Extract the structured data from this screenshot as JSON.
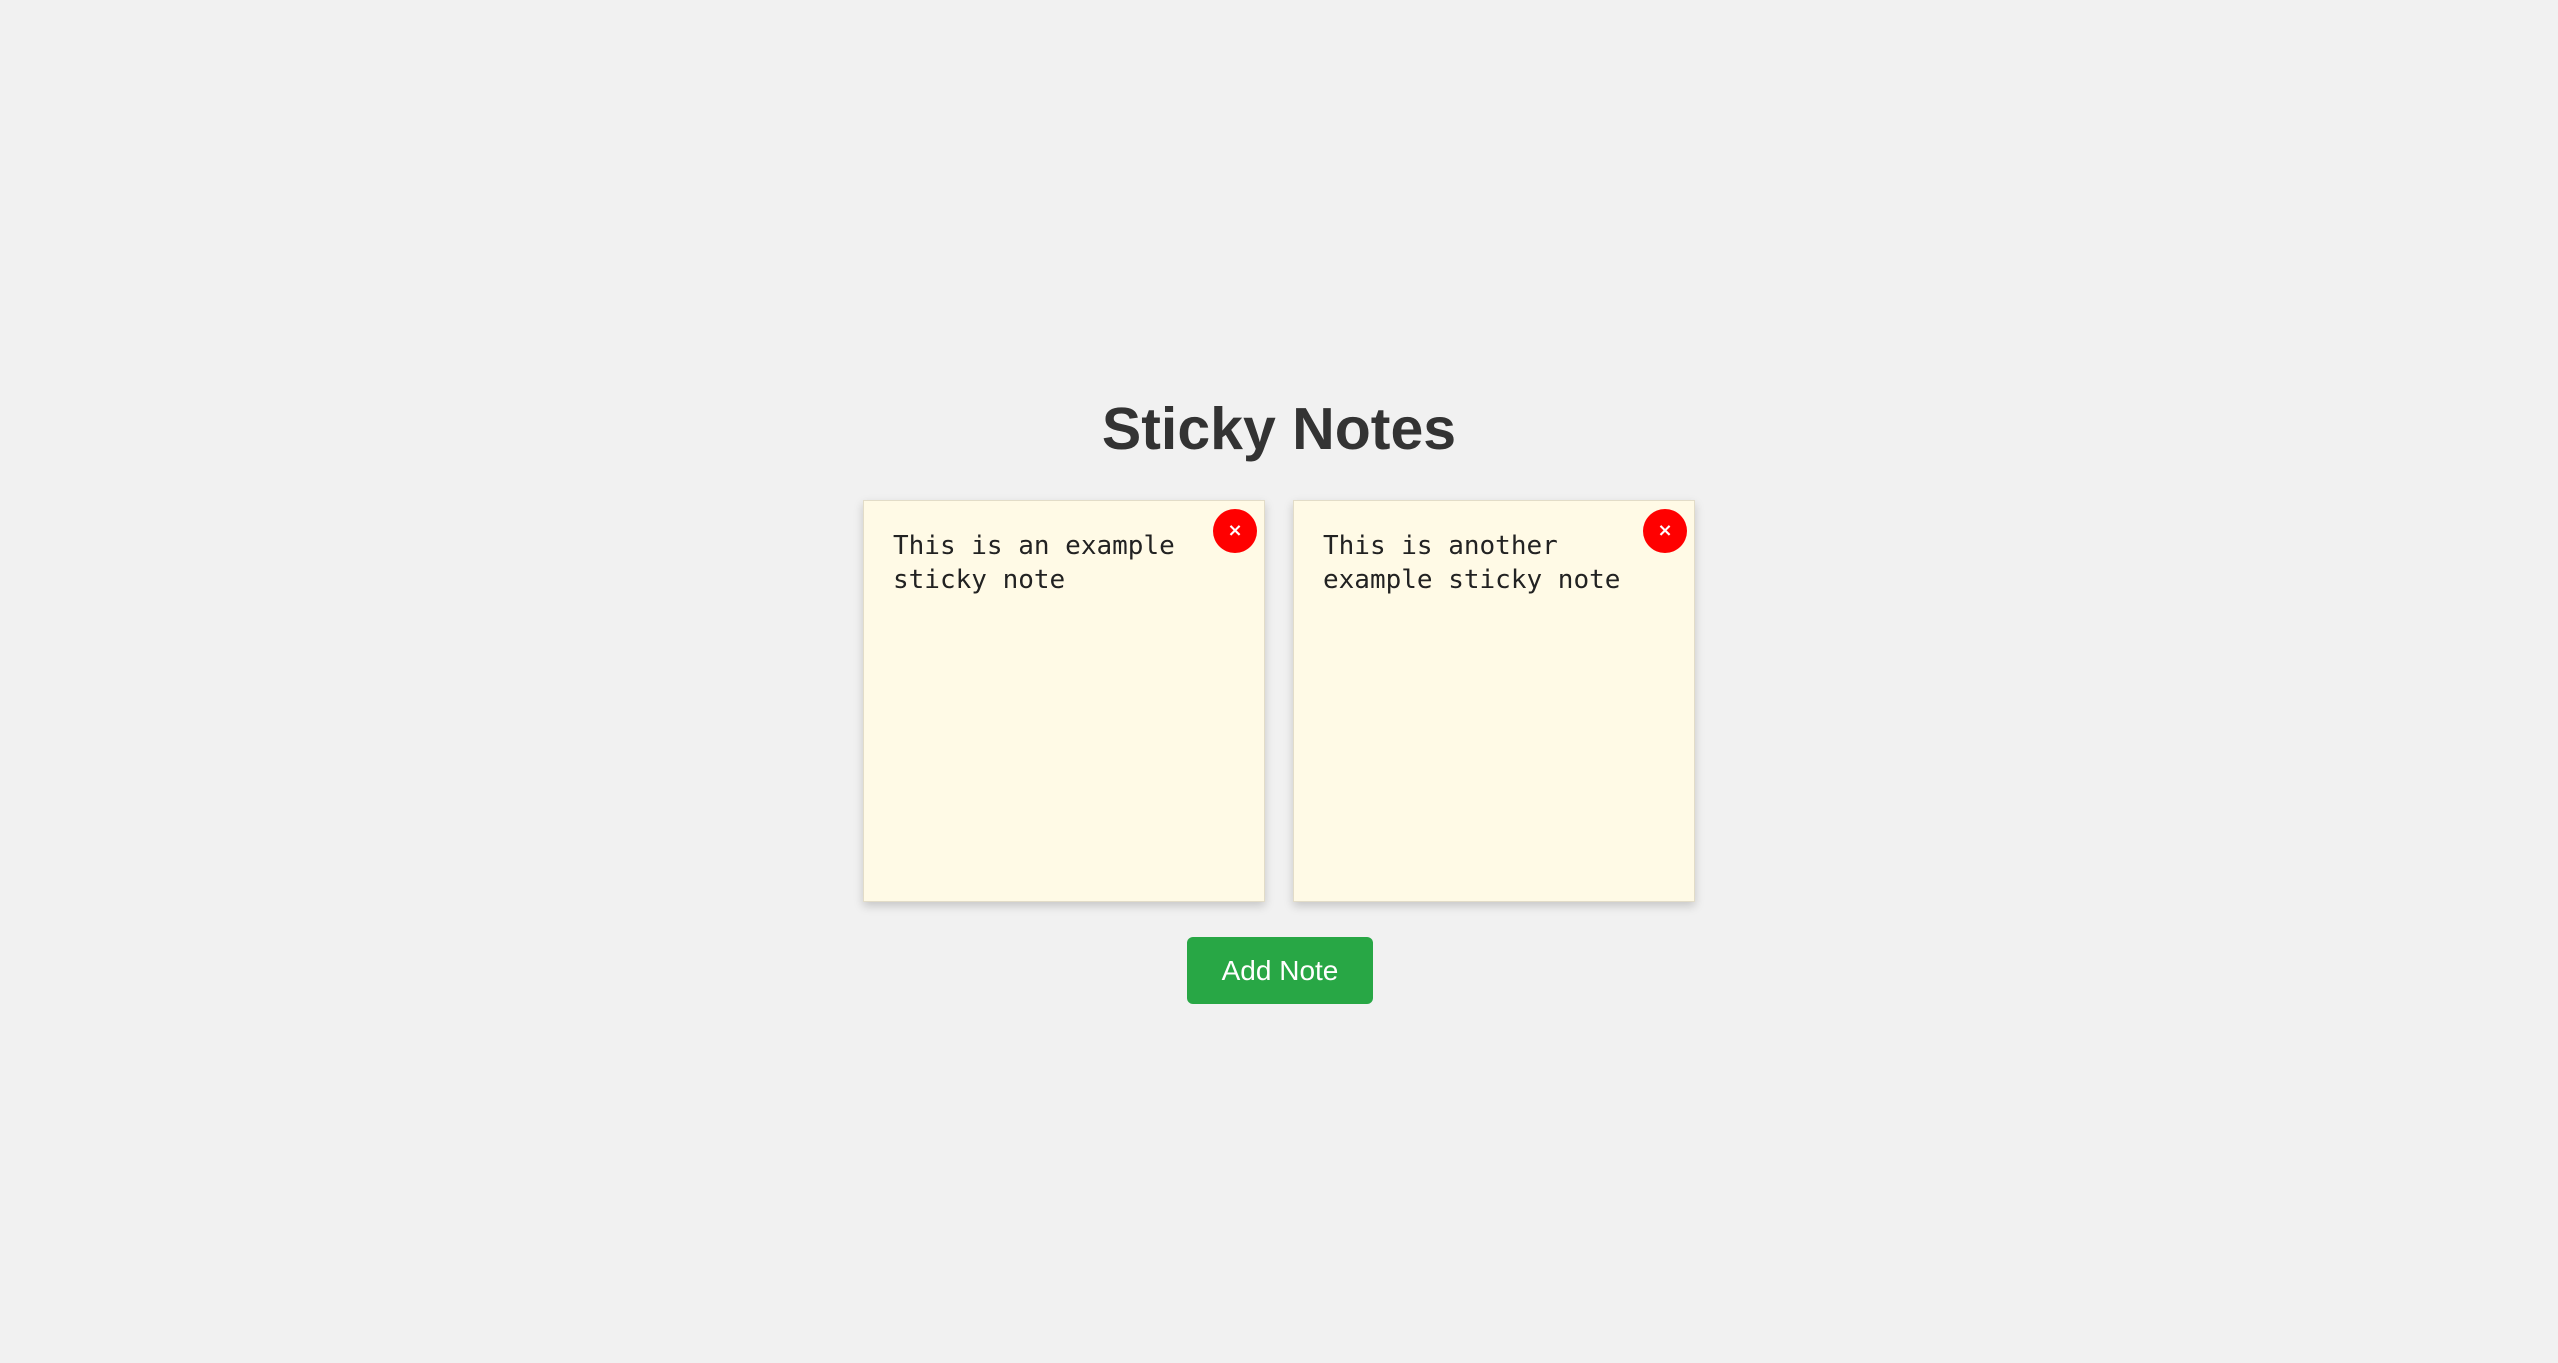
{
  "app": {
    "title": "Sticky Notes"
  },
  "notes": [
    {
      "text": "This is an example sticky note",
      "delete_label": "×",
      "delete_icon": "close-icon"
    },
    {
      "text": "This is another example sticky note",
      "delete_label": "×",
      "delete_icon": "close-icon"
    }
  ],
  "actions": {
    "add_note_label": "Add Note"
  },
  "colors": {
    "background": "#f1f1f1",
    "note_background": "#fffae6",
    "delete_button": "#ff0000",
    "add_button": "#28a745",
    "title_text": "#333333"
  }
}
